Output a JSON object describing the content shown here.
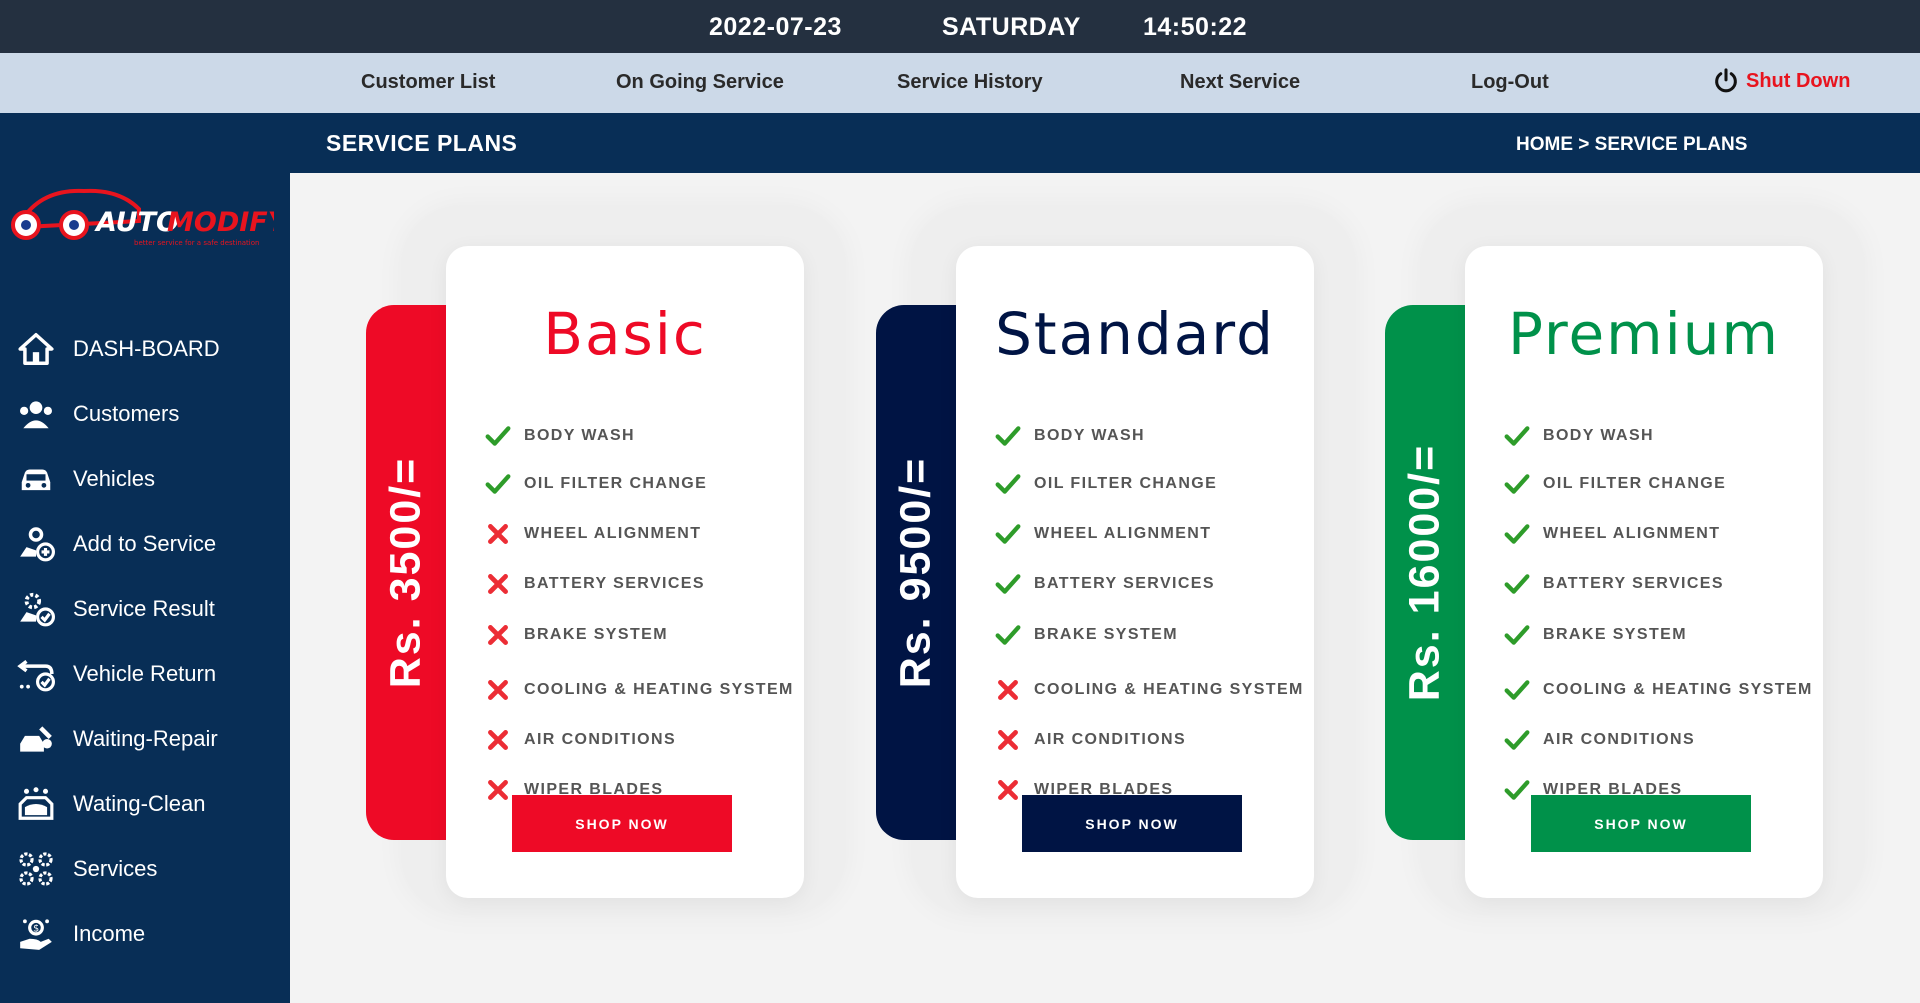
{
  "topbar": {
    "date": "2022-07-23",
    "day": "SATURDAY",
    "time": "14:50:22"
  },
  "nav": {
    "customer_list": "Customer List",
    "ongoing_service": "On Going Service",
    "service_history": "Service History",
    "next_service": "Next Service",
    "logout": "Log-Out",
    "shutdown": "Shut Down"
  },
  "logo": {
    "brand_part1": "AUTO",
    "brand_part2": "MODIFY",
    "tagline": "better service for a safe destination"
  },
  "sidebar": {
    "items": [
      {
        "label": "DASH-BOARD",
        "icon": "home-icon"
      },
      {
        "label": "Customers",
        "icon": "users-icon"
      },
      {
        "label": "Vehicles",
        "icon": "car-icon"
      },
      {
        "label": "Add to Service",
        "icon": "add-service-icon"
      },
      {
        "label": "Service Result",
        "icon": "service-result-icon"
      },
      {
        "label": "Vehicle Return",
        "icon": "return-icon"
      },
      {
        "label": "Waiting-Repair",
        "icon": "repair-icon"
      },
      {
        "label": "Wating-Clean",
        "icon": "clean-icon"
      },
      {
        "label": "Services",
        "icon": "services-icon"
      },
      {
        "label": "Income",
        "icon": "income-icon"
      }
    ]
  },
  "page": {
    "title": "SERVICE PLANS",
    "breadcrumb": "HOME > SERVICE PLANS"
  },
  "colors": {
    "basic": "#ee0a26",
    "standard": "#001444",
    "premium": "#00914a",
    "check": "#2e9c2a",
    "cross": "#ec2d35"
  },
  "plans": [
    {
      "name": "Basic",
      "price": "Rs. 3500/=",
      "button": "SHOP NOW",
      "features": [
        {
          "label": "BODY WASH",
          "included": true
        },
        {
          "label": "OIL FILTER CHANGE",
          "included": true
        },
        {
          "label": "WHEEL ALIGNMENT",
          "included": false
        },
        {
          "label": "BATTERY SERVICES",
          "included": false
        },
        {
          "label": "BRAKE SYSTEM",
          "included": false
        },
        {
          "label": "COOLING & HEATING SYSTEM",
          "included": false
        },
        {
          "label": "AIR CONDITIONS",
          "included": false
        },
        {
          "label": "WIPER BLADES",
          "included": false
        }
      ]
    },
    {
      "name": "Standard",
      "price": "Rs. 9500/=",
      "button": "SHOP NOW",
      "features": [
        {
          "label": "BODY WASH",
          "included": true
        },
        {
          "label": "OIL FILTER CHANGE",
          "included": true
        },
        {
          "label": "WHEEL ALIGNMENT",
          "included": true
        },
        {
          "label": "BATTERY SERVICES",
          "included": true
        },
        {
          "label": "BRAKE SYSTEM",
          "included": true
        },
        {
          "label": "COOLING & HEATING SYSTEM",
          "included": false
        },
        {
          "label": "AIR CONDITIONS",
          "included": false
        },
        {
          "label": "WIPER BLADES",
          "included": false
        }
      ]
    },
    {
      "name": "Premium",
      "price": "Rs. 16000/=",
      "button": "SHOP NOW",
      "features": [
        {
          "label": "BODY WASH",
          "included": true
        },
        {
          "label": "OIL FILTER CHANGE",
          "included": true
        },
        {
          "label": "WHEEL ALIGNMENT",
          "included": true
        },
        {
          "label": "BATTERY SERVICES",
          "included": true
        },
        {
          "label": "BRAKE SYSTEM",
          "included": true
        },
        {
          "label": "COOLING & HEATING SYSTEM",
          "included": true
        },
        {
          "label": "AIR CONDITIONS",
          "included": true
        },
        {
          "label": "WIPER BLADES",
          "included": true
        }
      ]
    }
  ]
}
